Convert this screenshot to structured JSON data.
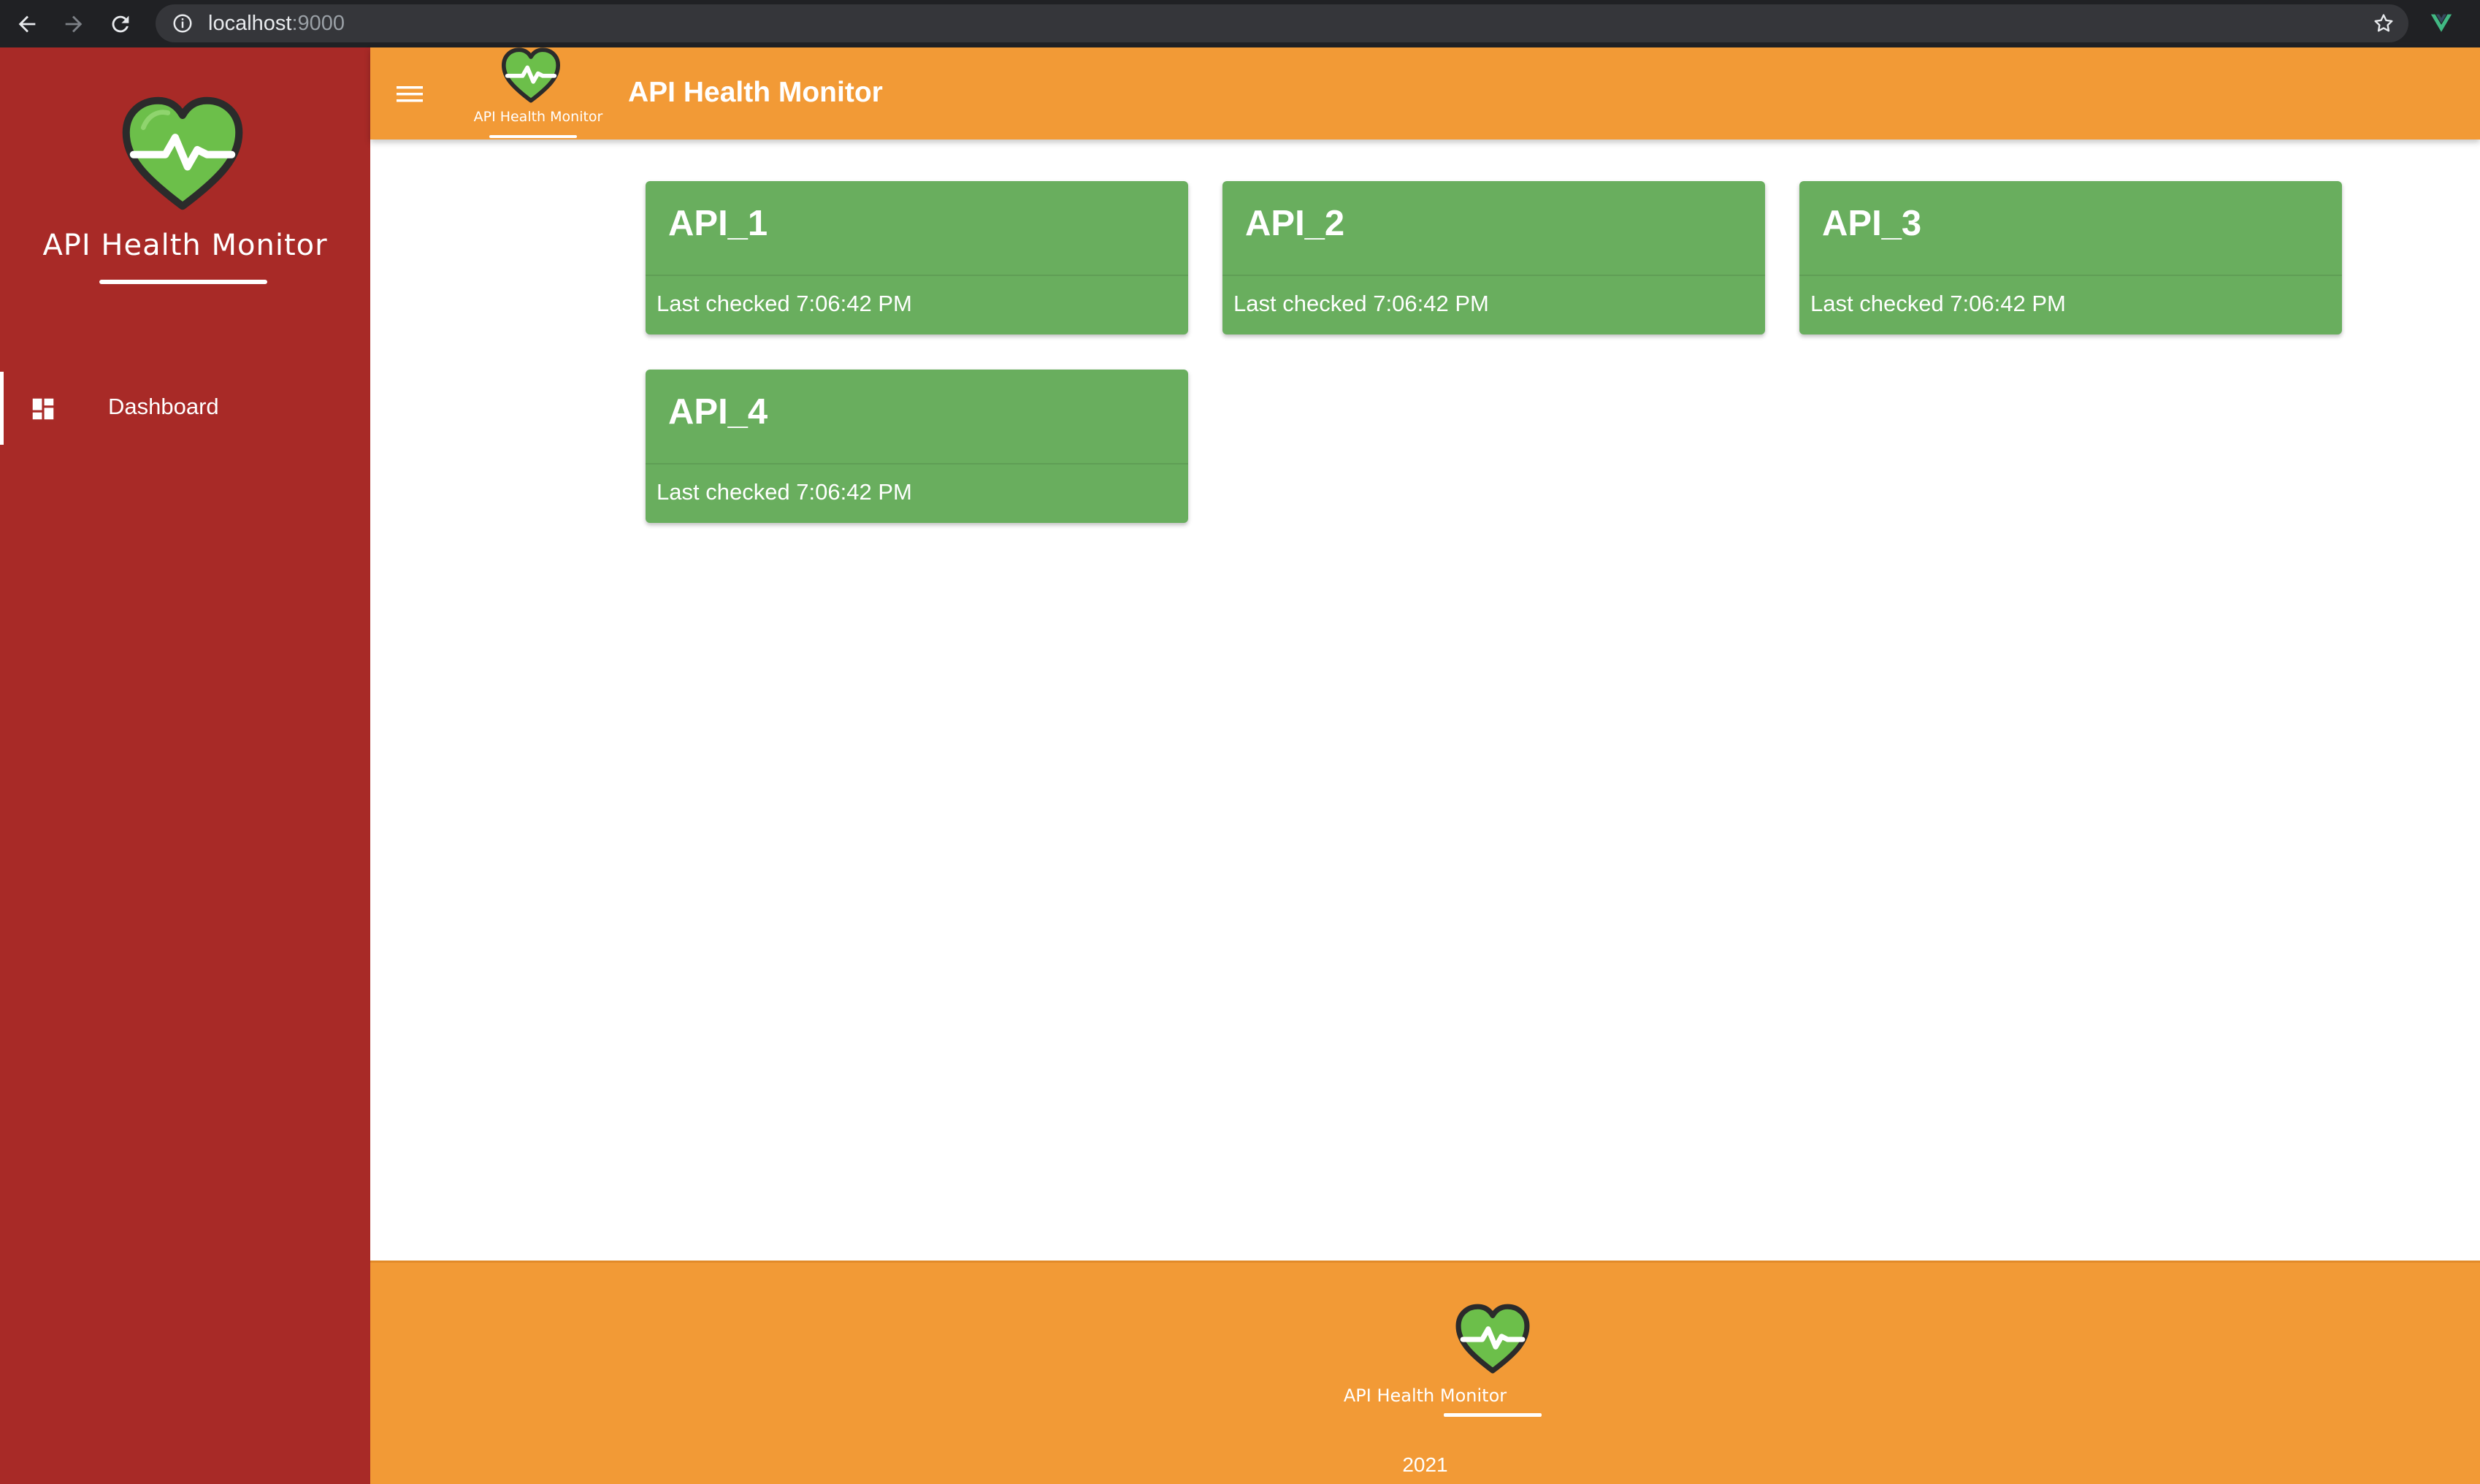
{
  "browser": {
    "url_host": "localhost",
    "url_port": ":9000",
    "icons": [
      "back-arrow-icon",
      "forward-arrow-icon",
      "reload-icon",
      "info-icon",
      "star-icon",
      "vue-devtools-icon"
    ]
  },
  "sidebar": {
    "brand_title": "API Health Monitor",
    "items": [
      {
        "label": "Dashboard",
        "icon": "dashboard-icon",
        "active": true
      }
    ]
  },
  "appbar": {
    "logo_text": "API Health Monitor",
    "title": "API Health Monitor"
  },
  "apis": [
    {
      "name": "API_1",
      "status_text": "Last checked 7:06:42 PM"
    },
    {
      "name": "API_2",
      "status_text": "Last checked 7:06:42 PM"
    },
    {
      "name": "API_3",
      "status_text": "Last checked 7:06:42 PM"
    },
    {
      "name": "API_4",
      "status_text": "Last checked 7:06:42 PM"
    }
  ],
  "footer": {
    "brand_title": "API Health Monitor",
    "year": "2021"
  },
  "colors": {
    "sidebar": "#a82a27",
    "appbar": "#f29a36",
    "card_healthy": "#69ae5e",
    "heart_green": "#6cbf4a",
    "heart_outline": "#2b2b2b"
  }
}
